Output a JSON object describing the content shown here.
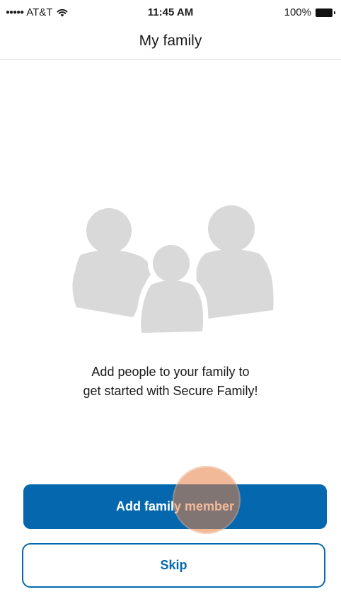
{
  "status_bar": {
    "signal_dots": "●●●●●",
    "carrier": "AT&T",
    "wifi_icon": "wifi-icon",
    "time": "11:45 AM",
    "battery_percent": "100%",
    "battery_icon": "battery-icon",
    "battery_level": 1.0
  },
  "nav": {
    "title": "My family"
  },
  "illustration": {
    "icon": "family-group-icon",
    "color": "#d9d9d9"
  },
  "message": {
    "line1": "Add people to your family to",
    "line2": "get started with Secure Family!"
  },
  "actions": {
    "primary_label": "Add family member",
    "secondary_label": "Skip"
  },
  "colors": {
    "accent": "#0568ae",
    "touch_indicator": "#e88046"
  }
}
